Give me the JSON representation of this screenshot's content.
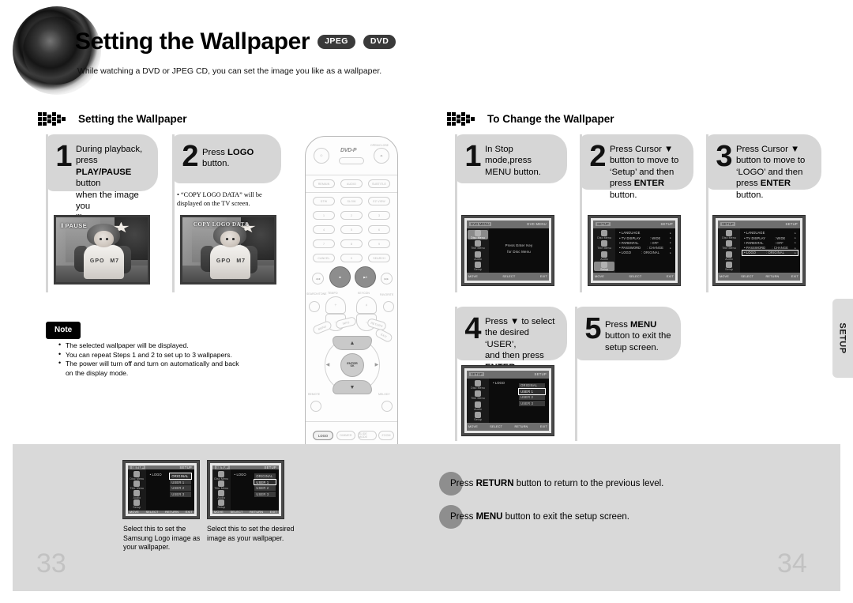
{
  "header": {
    "title": "Setting the Wallpaper",
    "badges": [
      "JPEG",
      "DVD"
    ],
    "subtitle": "While watching a DVD or JPEG CD, you can set the image you like as a wallpaper."
  },
  "left_section": {
    "heading": "Setting the Wallpaper",
    "steps": [
      {
        "num": "1",
        "line1": "During playback, press",
        "bold1": "PLAY/PAUSE",
        "line2": " button",
        "line3": "when the image you",
        "line4": "like comes up."
      },
      {
        "num": "2",
        "line1": "Press ",
        "bold1": "LOGO",
        "line2": "button."
      }
    ],
    "step2_bullet": "• “COPY LOGO DATA” will be\n   displayed on the TV screen.",
    "photo1_osd": "PAUSE",
    "photo2_osd": "COPY LOGO DATA",
    "photo_logo_left": "GPO",
    "photo_logo_right": "M7"
  },
  "note": {
    "label": "Note",
    "items": [
      "The selected wallpaper will be displayed.",
      "You can repeat Steps 1 and 2 to set up to 3 wallpapers.",
      "The power will turn off and turn on automatically and back on the display mode."
    ]
  },
  "right_section": {
    "heading": "To Change the Wallpaper",
    "steps": [
      {
        "num": "1",
        "l1": "In Stop",
        "l2": "mode,press",
        "l3": "MENU button."
      },
      {
        "num": "2",
        "l1": "Press Cursor ▼",
        "l2": "button to move to",
        "l3": "‘Setup’ and then",
        "l4pre": "press ",
        "l4b": "ENTER",
        "l4post": " button."
      },
      {
        "num": "3",
        "l1": "Press Cursor ▼",
        "l2": "button to move to",
        "l3": "‘LOGO’ and then",
        "l4pre": "press ",
        "l4b": "ENTER",
        "l4post": " button."
      },
      {
        "num": "4",
        "l1": "Press ▼ to select",
        "l2": "the desired ‘USER’,",
        "l3": "and then press",
        "l4b": "ENTER",
        "l4post": "."
      },
      {
        "num": "5",
        "l1pre": "Press ",
        "l1b": "MENU",
        "l2": "button to exit the",
        "l3": "setup screen."
      }
    ]
  },
  "osd_screens": {
    "disc_menu": {
      "title_left": "DVD MENU",
      "title_right": "DVD MENU",
      "sidebar": [
        "Disc Menu",
        "Title Menu",
        "Audio",
        "Setup"
      ],
      "active_sidebar": "Disc Menu",
      "center_line1": "Press Enter Key",
      "center_line2": "for Disc Menu",
      "footer": [
        "MOVE",
        "SELECT",
        "EXIT"
      ]
    },
    "setup_menu": {
      "title_left": "SETUP",
      "title_right": "SETUP",
      "sidebar": [
        "Disc Menu",
        "Title Menu",
        "Audio",
        "Setup"
      ],
      "active_sidebar": "Setup",
      "rows": [
        {
          "key": "LANGUAGE",
          "value": ""
        },
        {
          "key": "TV DISPLAY",
          "value": ": WIDE"
        },
        {
          "key": "PARENTAL",
          "value": ": OFF"
        },
        {
          "key": "PASSWORD",
          "value": ": CHANGE"
        },
        {
          "key": "LOGO",
          "value": ": ORIGINAL"
        }
      ],
      "selected_row_step3": "LOGO",
      "footer": [
        "MOVE",
        "SELECT",
        "RETURN",
        "EXIT"
      ]
    },
    "logo_select": {
      "title_right": "SETUP",
      "row_label": "LOGO",
      "options": [
        "ORIGINAL",
        "USER 1",
        "USER 2",
        "USER 3"
      ],
      "selected_step4": "USER 1",
      "selected_bottom_left": "ORIGINAL",
      "selected_bottom_right": "USER 1",
      "footer": [
        "MOVE",
        "SELECT",
        "RETURN",
        "EXIT"
      ]
    }
  },
  "bottom_captions": {
    "left": "Select this to set the\nSamsung Logo image as\nyour wallpaper.",
    "right": "Select this to set the desired\nimage as your wallpaper."
  },
  "press_lines": [
    {
      "pre": "Press ",
      "bold": "RETURN",
      "post": " button to return to the previous level."
    },
    {
      "pre": "Press ",
      "bold": "MENU",
      "post": " button to exit the setup screen."
    }
  ],
  "side_tab": "SETUP",
  "page_numbers": {
    "left": "33",
    "right": "34"
  },
  "colors": {
    "step_card_bg": "#d6d6d6",
    "panel_bg": "#d9d9d9",
    "badge_bg": "#3a3a3a",
    "page_number": "#c2c2c2"
  },
  "remote": {
    "brand": "DVD-P",
    "top_buttons": [
      "POWER",
      "OPEN/CLOSE"
    ],
    "row1": [
      "REMAIN",
      "AUDIO",
      "SUBTITLE"
    ],
    "row2": [
      "DTW",
      "SLOW",
      "EZ VIEW"
    ],
    "numbers": [
      "1",
      "2",
      "3",
      "4",
      "5",
      "6",
      "7",
      "8",
      "9",
      "CANCEL",
      "0",
      "SEARCH"
    ],
    "transport": [
      "REW",
      "STOP",
      "PLAY/PAUSE",
      "FF"
    ],
    "dial_labels": [
      "TEMPO",
      "KEYCON"
    ],
    "side_labels": [
      "SEARCH/TONE",
      "FAVORITE",
      "REMOTE",
      "MELODY"
    ],
    "dpad": {
      "up": "▲",
      "down": "▼",
      "left": "◀",
      "right": "▶",
      "center": "ENTER"
    },
    "bottom_buttons": [
      "LOGO",
      "DIMMER",
      "SLIDE MODE",
      "ZOOM",
      "EFFECT"
    ]
  }
}
